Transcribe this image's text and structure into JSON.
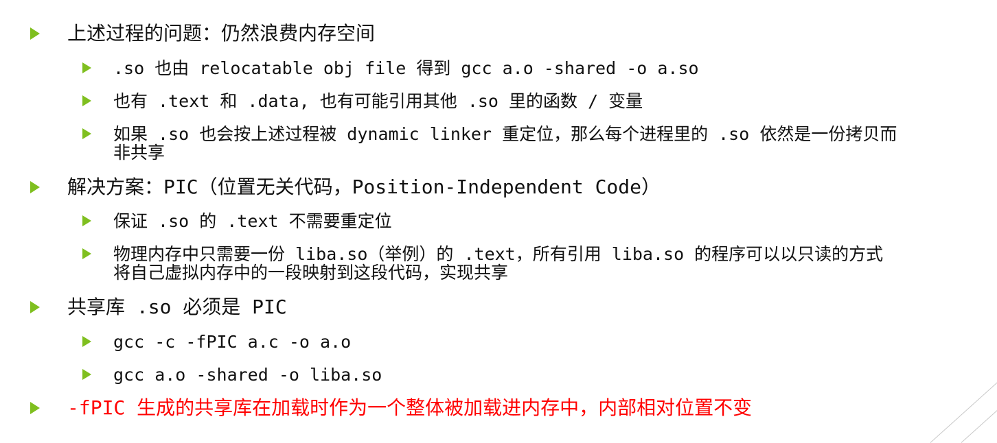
{
  "items": [
    {
      "level": 1,
      "text": "上述过程的问题：仍然浪费内存空间"
    },
    {
      "level": 2,
      "text": ".so 也由 relocatable obj file 得到 gcc a.o -shared -o a.so"
    },
    {
      "level": 2,
      "text": "也有 .text 和 .data, 也有可能引用其他 .so 里的函数 / 变量"
    },
    {
      "level": 2,
      "text": "如果 .so 也会按上述过程被 dynamic linker 重定位，那么每个进程里的 .so 依然是一份拷贝而",
      "text_cont": "非共享"
    },
    {
      "level": 1,
      "text": "解决方案：PIC（位置无关代码，Position-Independent Code）"
    },
    {
      "level": 2,
      "text": "保证 .so 的 .text 不需要重定位"
    },
    {
      "level": 2,
      "text": "物理内存中只需要一份 liba.so（举例）的 .text，所有引用 liba.so 的程序可以以只读的方式",
      "text_cont": "将自己虚拟内存中的一段映射到这段代码，实现共享"
    },
    {
      "level": 1,
      "text": "共享库 .so 必须是 PIC"
    },
    {
      "level": 2,
      "text": "gcc -c -fPIC a.c -o a.o"
    },
    {
      "level": 2,
      "text": "gcc a.o -shared -o liba.so"
    },
    {
      "level": 1,
      "text": "-fPIC 生成的共享库在加载时作为一个整体被加载进内存中，内部相对位置不变",
      "color": "#ff0000"
    }
  ],
  "theme": {
    "bullet_color": "#7fbf1f",
    "text_color": "#111111",
    "highlight_color": "#ff0000",
    "decor_line_color": "#c9c9c9"
  }
}
